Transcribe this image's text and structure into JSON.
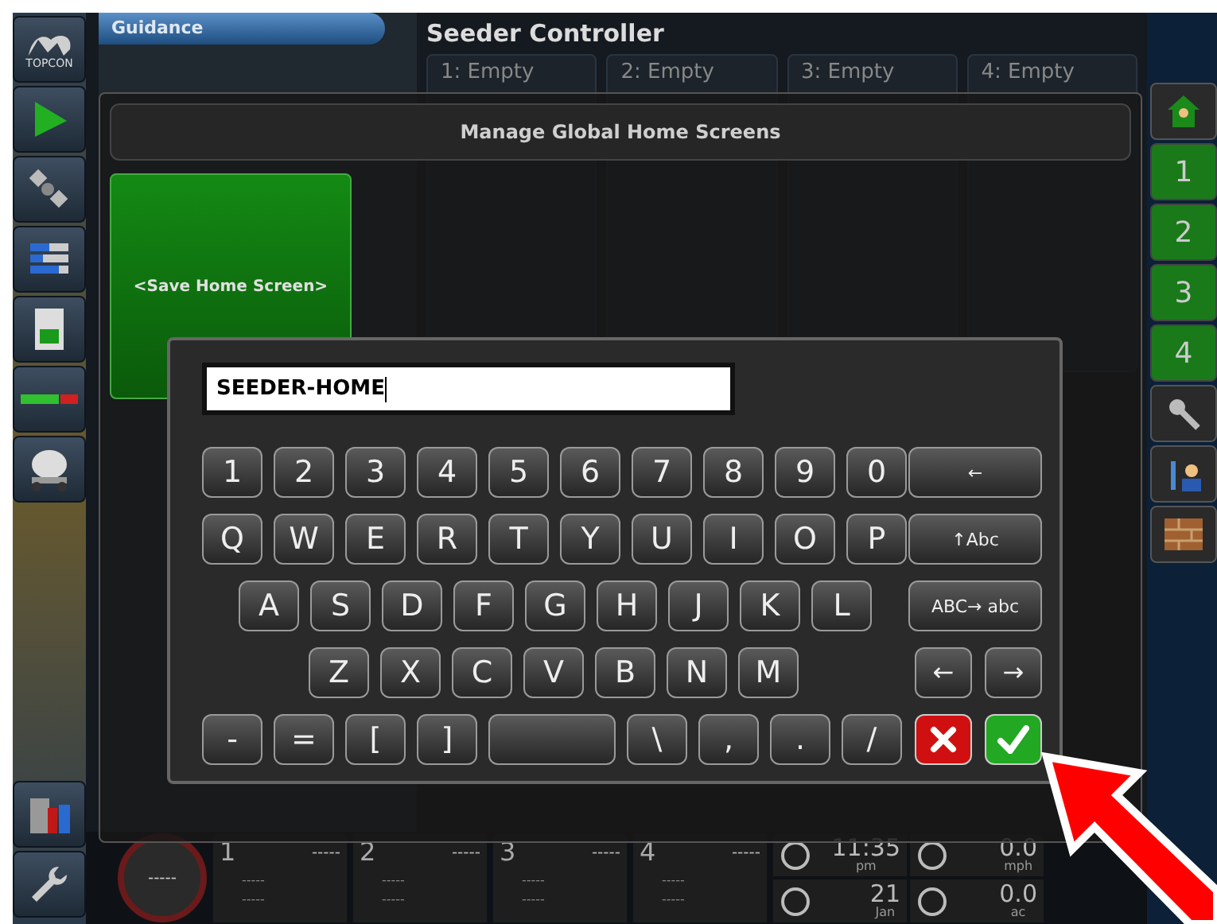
{
  "sidebar": {
    "logo_text": "TOPCON"
  },
  "guidance": {
    "title": "Guidance"
  },
  "seeder": {
    "title": "Seeder Controller",
    "tanks": [
      {
        "label": "1: Empty"
      },
      {
        "label": "2: Empty"
      },
      {
        "label": "3: Empty"
      },
      {
        "label": "4: Empty"
      }
    ]
  },
  "home_buttons": [
    {
      "label": "1",
      "selected": false
    },
    {
      "label": "2",
      "selected": false
    },
    {
      "label": "3",
      "selected": false
    },
    {
      "label": "4",
      "selected": false
    }
  ],
  "dialog": {
    "title": "Manage Global Home Screens",
    "save_tile": "<Save Home Screen>"
  },
  "keyboard": {
    "value": "SEEDER-HOME",
    "rows": [
      {
        "keys": [
          {
            "kind": "char",
            "label": "1"
          },
          {
            "kind": "char",
            "label": "2"
          },
          {
            "kind": "char",
            "label": "3"
          },
          {
            "kind": "char",
            "label": "4"
          },
          {
            "kind": "char",
            "label": "5"
          },
          {
            "kind": "char",
            "label": "6"
          },
          {
            "kind": "char",
            "label": "7"
          },
          {
            "kind": "char",
            "label": "8"
          },
          {
            "kind": "char",
            "label": "9"
          },
          {
            "kind": "char",
            "label": "0"
          }
        ],
        "controls": [
          {
            "kind": "action",
            "label": "←"
          }
        ]
      },
      {
        "keys": [
          {
            "kind": "char",
            "label": "Q"
          },
          {
            "kind": "char",
            "label": "W"
          },
          {
            "kind": "char",
            "label": "E"
          },
          {
            "kind": "char",
            "label": "R"
          },
          {
            "kind": "char",
            "label": "T"
          },
          {
            "kind": "char",
            "label": "Y"
          },
          {
            "kind": "char",
            "label": "U"
          },
          {
            "kind": "char",
            "label": "I"
          },
          {
            "kind": "char",
            "label": "O"
          },
          {
            "kind": "char",
            "label": "P"
          }
        ],
        "controls": [
          {
            "kind": "action",
            "label": "↑Abc"
          }
        ]
      },
      {
        "keys": [
          {
            "kind": "char",
            "label": "A"
          },
          {
            "kind": "char",
            "label": "S"
          },
          {
            "kind": "char",
            "label": "D"
          },
          {
            "kind": "char",
            "label": "F"
          },
          {
            "kind": "char",
            "label": "G"
          },
          {
            "kind": "char",
            "label": "H"
          },
          {
            "kind": "char",
            "label": "J"
          },
          {
            "kind": "char",
            "label": "K"
          },
          {
            "kind": "char",
            "label": "L"
          }
        ],
        "controls": [
          {
            "kind": "action",
            "label": "ABC→ abc"
          }
        ]
      },
      {
        "keys": [
          {
            "kind": "char",
            "label": "Z"
          },
          {
            "kind": "char",
            "label": "X"
          },
          {
            "kind": "char",
            "label": "C"
          },
          {
            "kind": "char",
            "label": "V"
          },
          {
            "kind": "char",
            "label": "B"
          },
          {
            "kind": "char",
            "label": "N"
          },
          {
            "kind": "char",
            "label": "M"
          }
        ],
        "controls": [
          {
            "kind": "nav",
            "label": "←"
          },
          {
            "kind": "nav",
            "label": "→"
          }
        ]
      },
      {
        "keys": [
          {
            "kind": "char",
            "label": "-"
          },
          {
            "kind": "char",
            "label": "="
          },
          {
            "kind": "char",
            "label": "["
          },
          {
            "kind": "char",
            "label": "]"
          },
          {
            "kind": "space"
          },
          {
            "kind": "char",
            "label": "\\"
          },
          {
            "kind": "char",
            "label": ","
          },
          {
            "kind": "char",
            "label": "."
          },
          {
            "kind": "char",
            "label": "/"
          }
        ],
        "controls": [
          {
            "kind": "cancel"
          },
          {
            "kind": "ok"
          }
        ]
      }
    ]
  },
  "status_bar": {
    "gauge": "-----",
    "sections": [
      {
        "number": "1",
        "value": "-----",
        "row_1": "-----",
        "row_2": "-----"
      },
      {
        "number": "2",
        "value": "-----",
        "row_1": "-----",
        "row_2": "-----"
      },
      {
        "number": "3",
        "value": "-----",
        "row_1": "-----",
        "row_2": "-----"
      },
      {
        "number": "4",
        "value": "-----",
        "row_1": "-----",
        "row_2": "-----"
      }
    ],
    "time": "11:35",
    "time_unit": "pm",
    "speed": "0.0",
    "speed_unit": "mph",
    "date": "21",
    "month": "Jan",
    "area": "0.0",
    "area_unit": "ac"
  }
}
